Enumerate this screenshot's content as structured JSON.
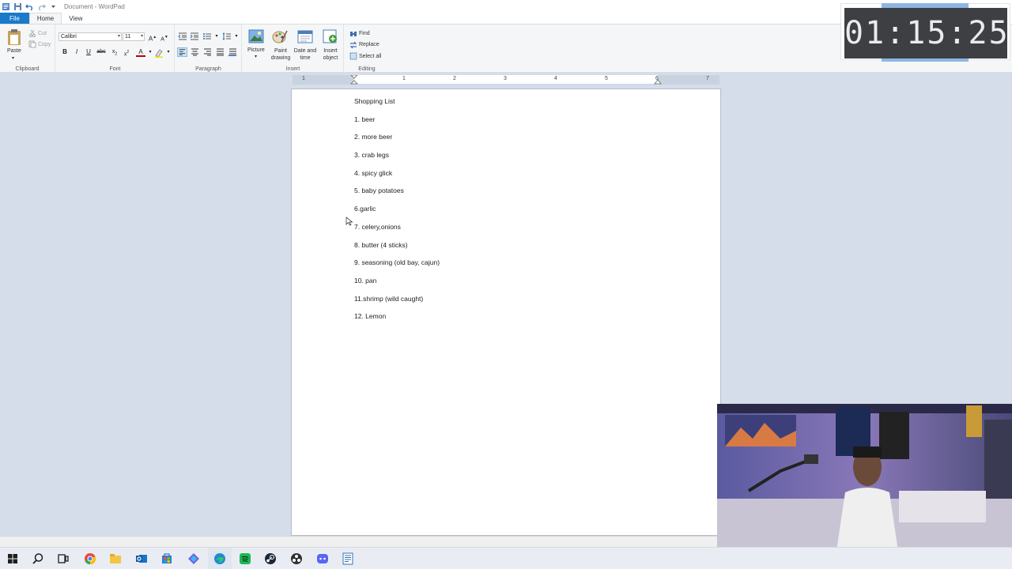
{
  "window": {
    "title": "Document - WordPad"
  },
  "tabs": [
    {
      "label": "File"
    },
    {
      "label": "Home"
    },
    {
      "label": "View"
    }
  ],
  "ribbon": {
    "clipboard": {
      "label": "Clipboard",
      "paste": "Paste",
      "cut": "Cut",
      "copy": "Copy"
    },
    "font": {
      "label": "Font",
      "family": "Calibri",
      "size": "11"
    },
    "paragraph": {
      "label": "Paragraph"
    },
    "insert": {
      "label": "Insert",
      "picture": "Picture",
      "paint_drawing": "Paint drawing",
      "date_time": "Date and time",
      "insert_object": "Insert object"
    },
    "editing": {
      "label": "Editing",
      "find": "Find",
      "replace": "Replace",
      "select_all": "Select all"
    }
  },
  "ruler": {
    "numbers": [
      "1",
      "1",
      "2",
      "3",
      "4",
      "5",
      "6",
      "7"
    ]
  },
  "document": {
    "lines": [
      "Shopping List",
      "1. beer",
      "2. more beer",
      "3. crab legs",
      "4. spicy glick",
      "5. baby potatoes",
      "6.garlic",
      "7. celery,onions",
      "8. butter (4 sticks)",
      "9. seasoning (old bay, cajun)",
      "10. pan",
      "11.shrimp (wild caught)",
      "12. Lemon"
    ]
  },
  "timer": {
    "display": "01:15:25"
  },
  "colors": {
    "accent": "#1979ca",
    "workspace": "#d4dde9",
    "timer_bg": "#3d3f43"
  },
  "taskbar": {
    "icons": [
      "windows-start-icon",
      "search-icon",
      "task-view-icon",
      "chrome-icon",
      "file-explorer-icon",
      "outlook-icon",
      "store-icon",
      "m365-icon",
      "edge-icon",
      "spotify-icon",
      "steam-icon",
      "obs-icon",
      "discord-icon",
      "wordpad-icon"
    ]
  }
}
